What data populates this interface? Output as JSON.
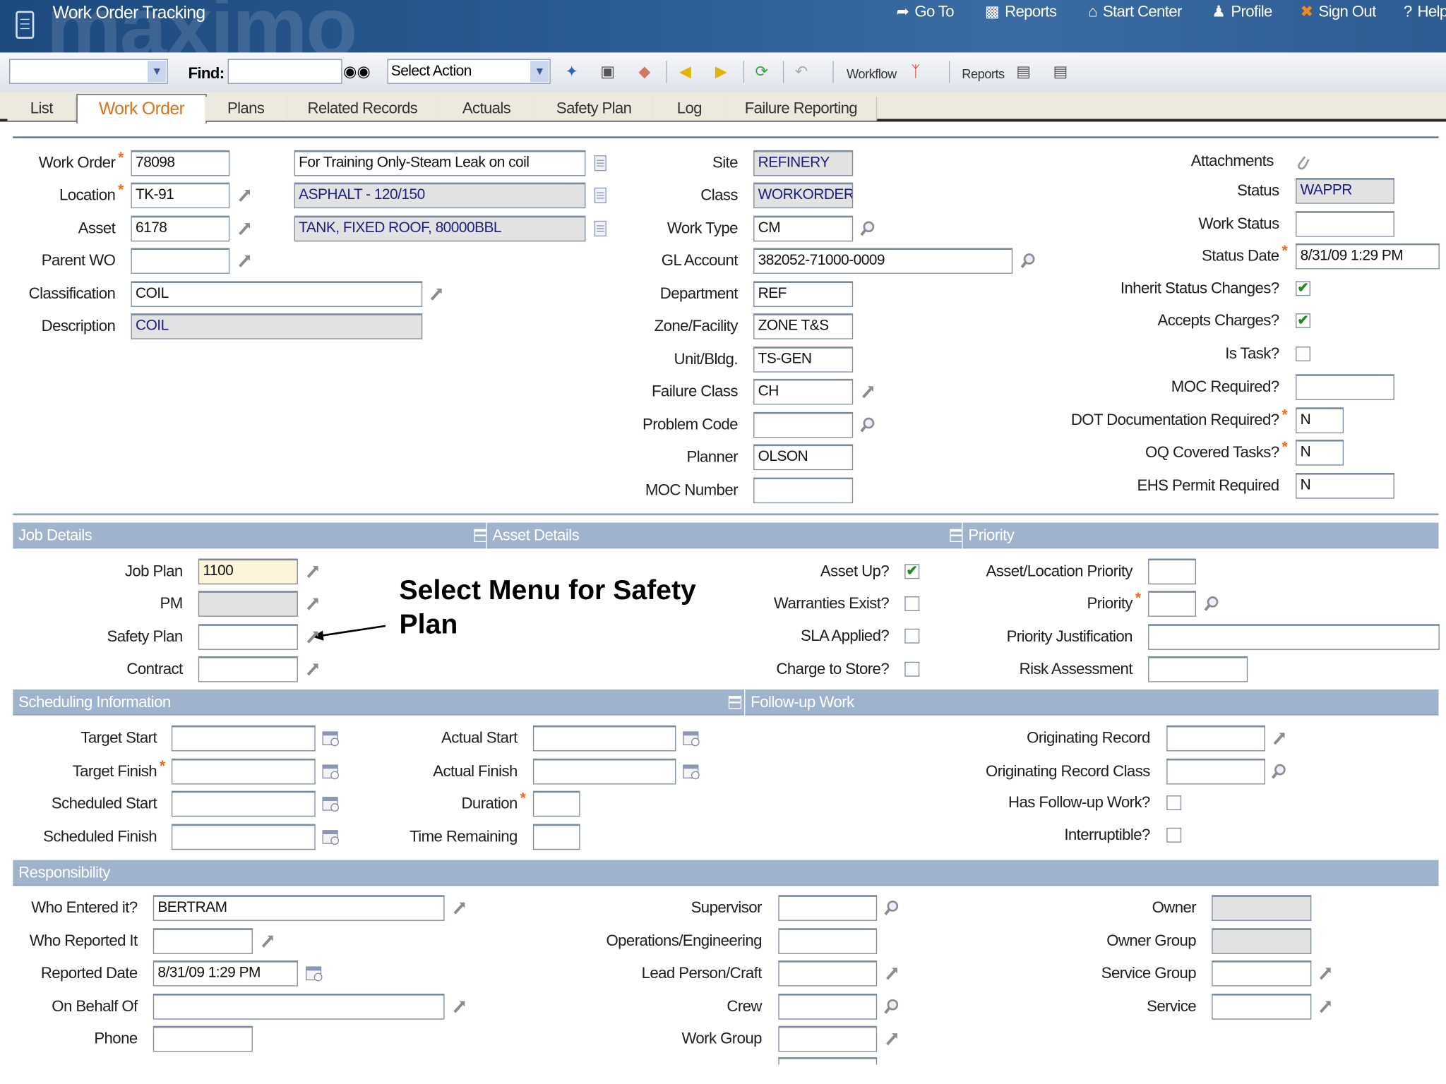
{
  "header": {
    "logo_text": "maximo",
    "title": "Work Order Tracking",
    "links": [
      {
        "label": "Go To",
        "icon": "go-to-icon"
      },
      {
        "label": "Reports",
        "icon": "reports-icon"
      },
      {
        "label": "Start Center",
        "icon": "home-icon"
      },
      {
        "label": "Profile",
        "icon": "profile-icon"
      },
      {
        "label": "Sign Out",
        "icon": "sign-out-icon"
      },
      {
        "label": "Help",
        "icon": "help-icon"
      }
    ]
  },
  "toolbar": {
    "query_select": "",
    "find_label": "Find:",
    "find_value": "",
    "action_select": "Select Action",
    "workflow_label": "Workflow",
    "reports_label": "Reports"
  },
  "tabs": [
    "List",
    "Work Order",
    "Plans",
    "Related Records",
    "Actuals",
    "Safety Plan",
    "Log",
    "Failure Reporting"
  ],
  "active_tab": "Work Order",
  "main": {
    "work_order": {
      "label": "Work Order",
      "value": "78098",
      "required": true
    },
    "wo_description": {
      "value": "For Training Only-Steam Leak on coil"
    },
    "location": {
      "label": "Location",
      "value": "TK-91",
      "required": true
    },
    "location_desc": {
      "value": "ASPHALT - 120/150"
    },
    "asset": {
      "label": "Asset",
      "value": "6178"
    },
    "asset_desc": {
      "value": "TANK, FIXED ROOF, 80000BBL"
    },
    "parent_wo": {
      "label": "Parent WO",
      "value": ""
    },
    "classification": {
      "label": "Classification",
      "value": "COIL"
    },
    "description": {
      "label": "Description",
      "value": "COIL"
    },
    "site": {
      "label": "Site",
      "value": "REFINERY"
    },
    "class": {
      "label": "Class",
      "value": "WORKORDER"
    },
    "work_type": {
      "label": "Work Type",
      "value": "CM"
    },
    "gl_account": {
      "label": "GL Account",
      "value": "382052-71000-0009"
    },
    "department": {
      "label": "Department",
      "value": "REF"
    },
    "zone_facility": {
      "label": "Zone/Facility",
      "value": "ZONE T&S"
    },
    "unit_bldg": {
      "label": "Unit/Bldg.",
      "value": "TS-GEN"
    },
    "failure_class": {
      "label": "Failure Class",
      "value": "CH"
    },
    "problem_code": {
      "label": "Problem Code",
      "value": ""
    },
    "planner": {
      "label": "Planner",
      "value": "OLSON"
    },
    "moc_number": {
      "label": "MOC Number",
      "value": ""
    },
    "attachments": {
      "label": "Attachments"
    },
    "status": {
      "label": "Status",
      "value": "WAPPR"
    },
    "work_status": {
      "label": "Work Status",
      "value": ""
    },
    "status_date": {
      "label": "Status Date",
      "value": "8/31/09 1:29 PM",
      "required": true
    },
    "inherit_status": {
      "label": "Inherit Status Changes?",
      "checked": true
    },
    "accepts_charges": {
      "label": "Accepts Charges?",
      "checked": true
    },
    "is_task": {
      "label": "Is Task?",
      "checked": false
    },
    "moc_required": {
      "label": "MOC Required?",
      "value": ""
    },
    "dot_doc": {
      "label": "DOT Documentation Required?",
      "value": "N",
      "required": true
    },
    "oq_tasks": {
      "label": "OQ Covered Tasks?",
      "value": "N",
      "required": true
    },
    "ehs_permit": {
      "label": "EHS Permit Required",
      "value": "N"
    }
  },
  "sections": {
    "job_details": "Job Details",
    "asset_details": "Asset Details",
    "priority": "Priority",
    "scheduling": "Scheduling Information",
    "follow_up": "Follow-up Work",
    "responsibility": "Responsibility"
  },
  "job": {
    "job_plan": {
      "label": "Job Plan",
      "value": "1100"
    },
    "pm": {
      "label": "PM",
      "value": ""
    },
    "safety_plan": {
      "label": "Safety Plan",
      "value": ""
    },
    "contract": {
      "label": "Contract",
      "value": ""
    }
  },
  "annotation": "Select Menu for Safety Plan",
  "asset_details": {
    "asset_up": {
      "label": "Asset Up?",
      "checked": true
    },
    "warranties": {
      "label": "Warranties Exist?",
      "checked": false
    },
    "sla": {
      "label": "SLA Applied?",
      "checked": false
    },
    "charge_store": {
      "label": "Charge to Store?",
      "checked": false
    }
  },
  "priority": {
    "asset_loc_priority": {
      "label": "Asset/Location Priority",
      "value": ""
    },
    "priority": {
      "label": "Priority",
      "value": "",
      "required": true
    },
    "justification": {
      "label": "Priority Justification",
      "value": ""
    },
    "risk": {
      "label": "Risk Assessment",
      "value": ""
    }
  },
  "scheduling": {
    "target_start": {
      "label": "Target Start",
      "value": ""
    },
    "target_finish": {
      "label": "Target Finish",
      "value": "",
      "required": true
    },
    "scheduled_start": {
      "label": "Scheduled Start",
      "value": ""
    },
    "scheduled_finish": {
      "label": "Scheduled Finish",
      "value": ""
    },
    "actual_start": {
      "label": "Actual Start",
      "value": ""
    },
    "actual_finish": {
      "label": "Actual Finish",
      "value": ""
    },
    "duration": {
      "label": "Duration",
      "value": "",
      "required": true
    },
    "time_remaining": {
      "label": "Time Remaining",
      "value": ""
    }
  },
  "follow_up": {
    "orig_record": {
      "label": "Originating Record",
      "value": ""
    },
    "orig_record_class": {
      "label": "Originating Record Class",
      "value": ""
    },
    "has_follow_up": {
      "label": "Has Follow-up Work?",
      "checked": false
    },
    "interruptible": {
      "label": "Interruptible?",
      "checked": false
    }
  },
  "responsibility": {
    "who_entered": {
      "label": "Who Entered it?",
      "value": "BERTRAM"
    },
    "who_reported": {
      "label": "Who Reported It",
      "value": ""
    },
    "reported_date": {
      "label": "Reported Date",
      "value": "8/31/09 1:29 PM"
    },
    "on_behalf_of": {
      "label": "On Behalf Of",
      "value": ""
    },
    "phone": {
      "label": "Phone",
      "value": ""
    },
    "supervisor": {
      "label": "Supervisor",
      "value": ""
    },
    "ops_eng": {
      "label": "Operations/Engineering",
      "value": ""
    },
    "lead": {
      "label": "Lead Person/Craft",
      "value": ""
    },
    "crew": {
      "label": "Crew",
      "value": ""
    },
    "work_group": {
      "label": "Work Group",
      "value": ""
    },
    "owner": {
      "label": "Owner",
      "value": ""
    },
    "owner_group": {
      "label": "Owner Group",
      "value": ""
    },
    "service_group": {
      "label": "Service Group",
      "value": ""
    },
    "service": {
      "label": "Service",
      "value": ""
    }
  },
  "colors": {
    "header": "#2a5a92",
    "section_bar": "#9fb4cc",
    "active_tab": "#d9731c",
    "required": "#f06a1a",
    "check": "#1c8a1c"
  }
}
